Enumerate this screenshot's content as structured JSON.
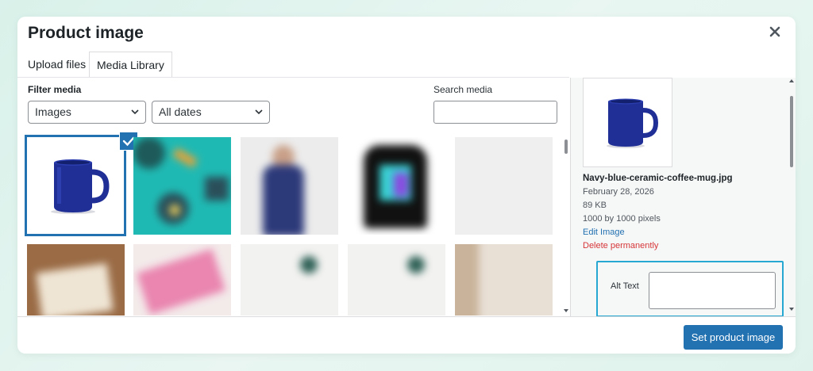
{
  "modal": {
    "title": "Product image",
    "tabs": [
      {
        "label": "Upload files",
        "active": false
      },
      {
        "label": "Media Library",
        "active": true
      }
    ]
  },
  "filters": {
    "label": "Filter media",
    "type_selected": "Images",
    "date_selected": "All dates"
  },
  "search": {
    "label": "Search media",
    "value": ""
  },
  "media_grid": {
    "items": [
      {
        "name": "mug",
        "selected": true
      },
      {
        "name": "teal-pattern",
        "selected": false
      },
      {
        "name": "navy-shirt-model",
        "selected": false
      },
      {
        "name": "black-hoodie",
        "selected": false
      },
      {
        "name": "light-gray-image",
        "selected": false
      },
      {
        "name": "wooden-sign",
        "selected": false
      },
      {
        "name": "pink-item",
        "selected": false
      },
      {
        "name": "white-plant-image-1",
        "selected": false
      },
      {
        "name": "white-plant-image-2",
        "selected": false
      },
      {
        "name": "interior-image",
        "selected": false
      }
    ]
  },
  "attachment_details": {
    "filename": "Navy-blue-ceramic-coffee-mug.jpg",
    "date": "February 28, 2026",
    "filesize": "89 KB",
    "dimensions": "1000 by 1000 pixels",
    "edit_link": "Edit Image",
    "delete_link": "Delete permanently",
    "alt_text_label": "Alt Text",
    "alt_text_value": ""
  },
  "footer": {
    "button_label": "Set product image"
  },
  "colors": {
    "accent": "#2271b1",
    "danger": "#d63638",
    "highlight": "#26a8d3",
    "mug_blue": "#1f2f96"
  },
  "icons": {
    "close": "close-icon",
    "check": "checkmark-icon",
    "chevron": "chevron-down-icon"
  }
}
